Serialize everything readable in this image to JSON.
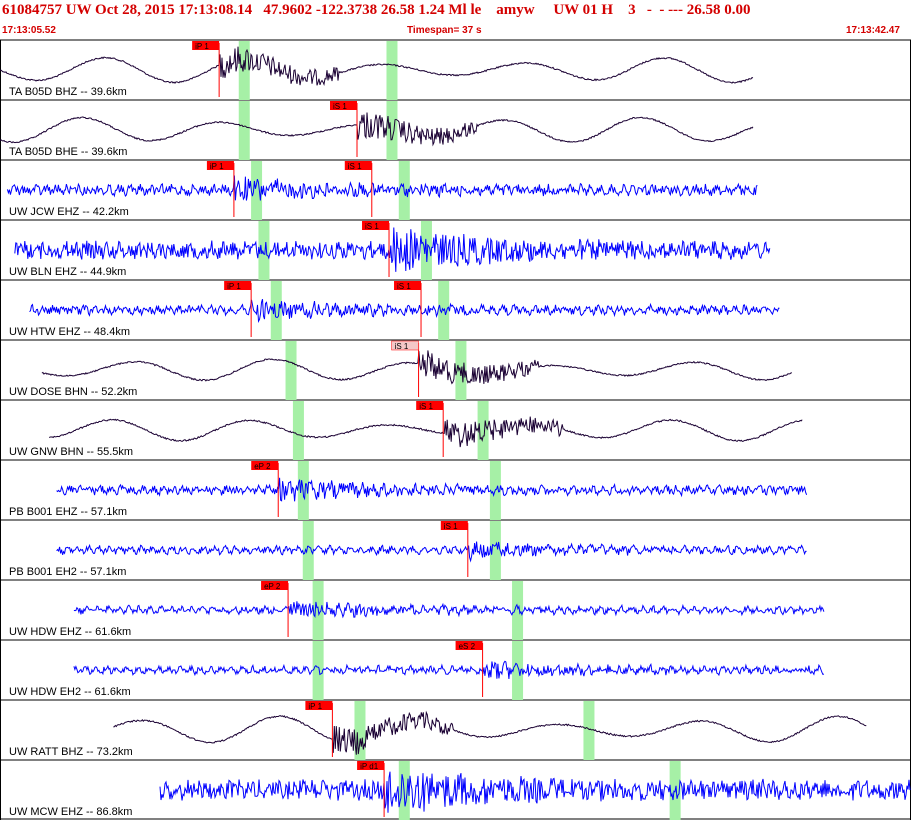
{
  "header": {
    "event_line": "61084757 UW Oct 28, 2015 17:13:08.14   47.9602 -122.3738 26.58 1.24 Ml le    amyw     UW 01 H    3   -  - --- 26.58 0.00",
    "start_time": "17:13:05.52",
    "timespan": "Timespan=  37 s",
    "end_time": "17:13:42.47"
  },
  "colors": {
    "header_red": "#d40000",
    "pick_red": "#ff0000",
    "pick_shaded": "#f4c7c7",
    "window_green": "#a6f0a6",
    "trace_blue": "#0000ff",
    "trace_dark": "#1a0033",
    "separator": "#000000"
  },
  "chart_data": {
    "type": "seismogram",
    "title": "61084757 UW Oct 28, 2015 17:13:08.14",
    "time_axis": {
      "start": "17:13:05.52",
      "end": "17:13:42.47",
      "span_s": 37
    },
    "traces": [
      {
        "label": "TA B05D BHZ -- 39.6km",
        "color": "dark",
        "style": "long",
        "start_s": 0.0,
        "end_s": 30.6,
        "amp": 0.35,
        "picks": [
          {
            "label": "iP 1",
            "t": 8.9
          }
        ],
        "windows": [
          {
            "t": 9.9
          },
          {
            "t": 15.9
          }
        ]
      },
      {
        "label": "TA B05D BHE -- 39.6km",
        "color": "dark",
        "style": "long",
        "start_s": 0.0,
        "end_s": 30.6,
        "amp": 0.35,
        "picks": [
          {
            "label": "iS 1",
            "t": 14.5
          }
        ],
        "windows": [
          {
            "t": 9.9
          },
          {
            "t": 15.9
          }
        ]
      },
      {
        "label": "UW JCW EHZ -- 42.2km",
        "color": "blue",
        "style": "short",
        "start_s": 0.3,
        "end_s": 30.8,
        "amp": 0.12,
        "picks": [
          {
            "label": "iP 1",
            "t": 9.5
          },
          {
            "label": "iS 1",
            "t": 15.1
          }
        ],
        "windows": [
          {
            "t": 10.4
          },
          {
            "t": 16.4
          }
        ]
      },
      {
        "label": "UW BLN EHZ -- 44.9km",
        "color": "blue",
        "style": "short",
        "start_s": 0.6,
        "end_s": 31.3,
        "amp": 0.22,
        "picks": [
          {
            "label": "iS 1",
            "t": 15.8
          }
        ],
        "windows": [
          {
            "t": 10.7
          },
          {
            "t": 17.3
          }
        ]
      },
      {
        "label": "UW HTW EHZ -- 48.4km",
        "color": "blue",
        "style": "short",
        "start_s": 1.2,
        "end_s": 31.7,
        "amp": 0.1,
        "picks": [
          {
            "label": "iP 1",
            "t": 10.2
          },
          {
            "label": "iS 1",
            "t": 17.1
          }
        ],
        "windows": [
          {
            "t": 11.2
          },
          {
            "t": 18.0
          }
        ]
      },
      {
        "label": "UW DOSE BHN -- 52.2km",
        "color": "dark",
        "style": "long",
        "start_s": 1.7,
        "end_s": 32.2,
        "amp": 0.3,
        "picks": [
          {
            "label": "iS 1",
            "t": 17.0,
            "shaded": true
          }
        ],
        "windows": [
          {
            "t": 11.8
          },
          {
            "t": 18.7
          }
        ]
      },
      {
        "label": "UW GNW BHN -- 55.5km",
        "color": "dark",
        "style": "long",
        "start_s": 2.0,
        "end_s": 32.6,
        "amp": 0.3,
        "picks": [
          {
            "label": "iS 1",
            "t": 18.0
          }
        ],
        "windows": [
          {
            "t": 12.1
          },
          {
            "t": 19.6
          }
        ]
      },
      {
        "label": "PB B001 EHZ -- 57.1km",
        "color": "blue",
        "style": "short",
        "start_s": 2.3,
        "end_s": 32.8,
        "amp": 0.1,
        "picks": [
          {
            "label": "eP 2",
            "t": 11.3
          }
        ],
        "windows": [
          {
            "t": 12.3
          },
          {
            "t": 20.1
          }
        ]
      },
      {
        "label": "PB B001 EH2 -- 57.1km",
        "color": "blue",
        "style": "short",
        "start_s": 2.3,
        "end_s": 32.8,
        "amp": 0.08,
        "picks": [
          {
            "label": "iS 1",
            "t": 19.0
          }
        ],
        "windows": [
          {
            "t": 12.5
          },
          {
            "t": 20.1
          }
        ]
      },
      {
        "label": "UW HDW EHZ -- 61.6km",
        "color": "blue",
        "style": "short",
        "start_s": 3.0,
        "end_s": 33.5,
        "amp": 0.08,
        "picks": [
          {
            "label": "eP 2",
            "t": 11.7
          }
        ],
        "windows": [
          {
            "t": 12.9
          },
          {
            "t": 21.0
          }
        ]
      },
      {
        "label": "UW HDW EH2 -- 61.6km",
        "color": "blue",
        "style": "short",
        "start_s": 3.0,
        "end_s": 33.5,
        "amp": 0.08,
        "picks": [
          {
            "label": "eS 2",
            "t": 19.6
          }
        ],
        "windows": [
          {
            "t": 12.9
          },
          {
            "t": 21.0
          }
        ]
      },
      {
        "label": "UW RATT BHZ -- 73.2km",
        "color": "dark",
        "style": "long",
        "start_s": 4.6,
        "end_s": 35.2,
        "amp": 0.38,
        "picks": [
          {
            "label": "iP 1",
            "t": 13.5
          }
        ],
        "windows": [
          {
            "t": 14.6
          },
          {
            "t": 23.9
          }
        ]
      },
      {
        "label": "UW MCW EHZ -- 86.8km",
        "color": "blue",
        "style": "short",
        "start_s": 6.5,
        "end_s": 37.0,
        "amp": 0.25,
        "picks": [
          {
            "label": "iP d1",
            "t": 15.6
          }
        ],
        "windows": [
          {
            "t": 16.4
          },
          {
            "t": 27.4
          }
        ]
      }
    ]
  }
}
